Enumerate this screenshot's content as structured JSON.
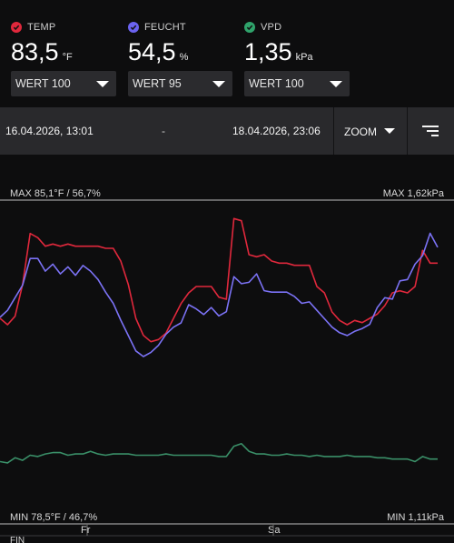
{
  "metrics": [
    {
      "label": "TEMP",
      "value": "83,5",
      "unit": "°F",
      "color": "#e0283c",
      "select": "WERT 100"
    },
    {
      "label": "FEUCHT",
      "value": "54,5",
      "unit": "%",
      "color": "#6b63f0",
      "select": "WERT 95"
    },
    {
      "label": "VPD",
      "value": "1,35",
      "unit": "kPa",
      "color": "#2fa36b",
      "select": "WERT 100"
    }
  ],
  "range": {
    "from": "16.04.2026, 13:01",
    "separator": "-",
    "to": "18.04.2026, 23:06",
    "zoom_label": "ZOOM"
  },
  "chart": {
    "max_left": "MAX 85,1°F / 56,7%",
    "max_right": "MAX 1,62kPa",
    "min_left": "MIN 78,5°F / 46,7%",
    "min_right": "MIN 1,11kPa",
    "day_labels": [
      "Fr",
      "Sa"
    ],
    "footer_label": "FIN",
    "colors": {
      "temp": "#e0283c",
      "humidity": "#7b72f5",
      "vpd": "#3a8f68",
      "grid": "#bdbdbd"
    }
  },
  "chart_data": {
    "type": "line",
    "x_start": "16.04.2026, 13:01",
    "x_end": "18.04.2026, 23:06",
    "x_ticks": [
      "Fr",
      "Sa"
    ],
    "series": [
      {
        "name": "TEMP",
        "unit": "°F",
        "ylim": [
          78.5,
          85.1
        ],
        "values": [
          80.3,
          80.0,
          80.4,
          81.9,
          84.3,
          84.1,
          83.7,
          83.8,
          83.7,
          83.8,
          83.7,
          83.7,
          83.7,
          83.7,
          83.6,
          83.6,
          83.0,
          81.9,
          80.3,
          79.5,
          79.2,
          79.3,
          79.6,
          80.3,
          81.0,
          81.5,
          81.8,
          81.8,
          81.8,
          81.3,
          81.2,
          85.0,
          84.9,
          83.3,
          83.2,
          83.3,
          83.0,
          82.9,
          82.9,
          82.8,
          82.8,
          82.8,
          81.8,
          81.5,
          80.6,
          80.2,
          80.0,
          80.2,
          80.1,
          80.3,
          80.5,
          80.9,
          81.5,
          81.6,
          81.5,
          81.8,
          83.5,
          82.9,
          82.9
        ]
      },
      {
        "name": "FEUCHT",
        "unit": "%",
        "ylim": [
          46.7,
          56.7
        ],
        "values": [
          49.5,
          50.0,
          50.9,
          51.8,
          53.7,
          53.7,
          52.8,
          53.3,
          52.6,
          53.1,
          52.5,
          53.2,
          52.8,
          52.2,
          51.3,
          50.5,
          49.3,
          48.2,
          47.1,
          46.7,
          47.0,
          47.5,
          48.3,
          48.8,
          49.1,
          50.4,
          50.1,
          49.7,
          50.2,
          49.6,
          49.9,
          52.4,
          51.9,
          52.0,
          52.6,
          51.4,
          51.3,
          51.3,
          51.3,
          51.0,
          50.5,
          50.6,
          50.0,
          49.4,
          48.8,
          48.4,
          48.2,
          48.5,
          48.7,
          49.0,
          50.2,
          50.9,
          50.8,
          52.1,
          52.2,
          53.3,
          53.9,
          55.5,
          54.5
        ]
      },
      {
        "name": "VPD",
        "unit": "kPa",
        "ylim": [
          1.11,
          1.62
        ],
        "values": [
          1.17,
          1.16,
          1.2,
          1.18,
          1.22,
          1.21,
          1.23,
          1.24,
          1.24,
          1.22,
          1.23,
          1.23,
          1.25,
          1.23,
          1.22,
          1.23,
          1.23,
          1.23,
          1.22,
          1.22,
          1.22,
          1.22,
          1.23,
          1.22,
          1.22,
          1.22,
          1.22,
          1.22,
          1.22,
          1.21,
          1.21,
          1.29,
          1.31,
          1.25,
          1.23,
          1.23,
          1.22,
          1.22,
          1.23,
          1.22,
          1.22,
          1.21,
          1.22,
          1.21,
          1.21,
          1.21,
          1.22,
          1.21,
          1.21,
          1.21,
          1.2,
          1.2,
          1.19,
          1.19,
          1.19,
          1.17,
          1.21,
          1.19,
          1.19
        ]
      }
    ]
  }
}
